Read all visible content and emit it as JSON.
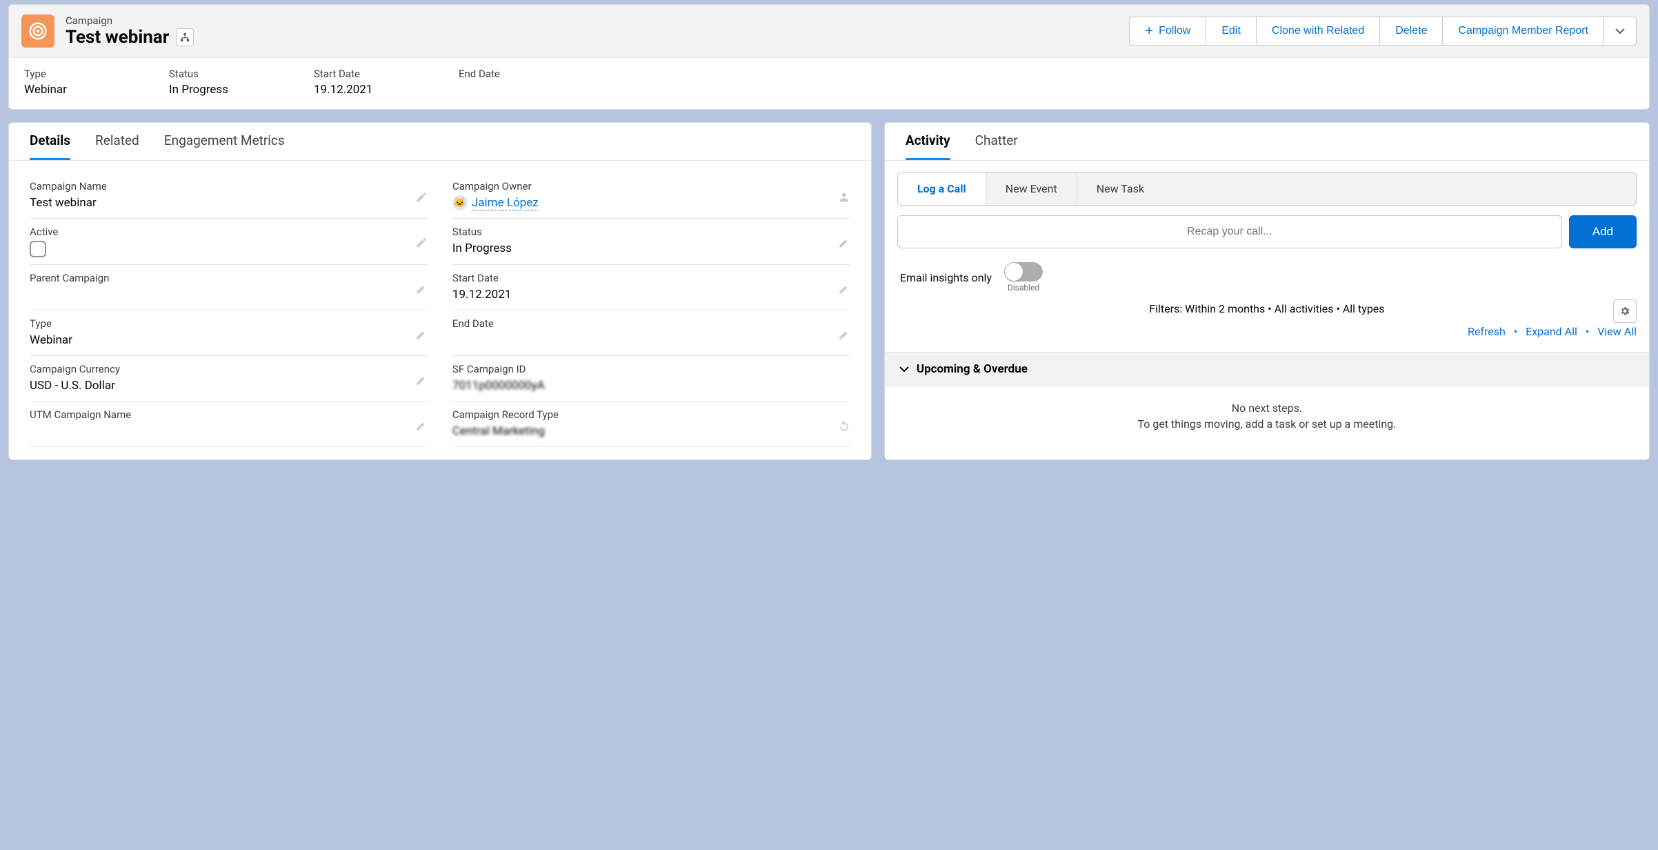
{
  "header": {
    "object_label": "Campaign",
    "record_title": "Test webinar",
    "actions": {
      "follow": "Follow",
      "edit": "Edit",
      "clone": "Clone with Related",
      "delete": "Delete",
      "member_report": "Campaign Member Report"
    },
    "highlights": [
      {
        "label": "Type",
        "value": "Webinar"
      },
      {
        "label": "Status",
        "value": "In Progress"
      },
      {
        "label": "Start Date",
        "value": "19.12.2021"
      },
      {
        "label": "End Date",
        "value": ""
      }
    ]
  },
  "left": {
    "tabs": {
      "details": "Details",
      "related": "Related",
      "engagement": "Engagement Metrics"
    },
    "fields": {
      "campaign_name": {
        "label": "Campaign Name",
        "value": "Test webinar"
      },
      "campaign_owner": {
        "label": "Campaign Owner",
        "value": "Jaime López"
      },
      "active": {
        "label": "Active"
      },
      "status": {
        "label": "Status",
        "value": "In Progress"
      },
      "parent_campaign": {
        "label": "Parent Campaign",
        "value": ""
      },
      "start_date": {
        "label": "Start Date",
        "value": "19.12.2021"
      },
      "type": {
        "label": "Type",
        "value": "Webinar"
      },
      "end_date": {
        "label": "End Date",
        "value": ""
      },
      "campaign_currency": {
        "label": "Campaign Currency",
        "value": "USD - U.S. Dollar"
      },
      "sf_campaign_id": {
        "label": "SF Campaign ID",
        "value": "7011p0000000yA"
      },
      "utm_campaign_name": {
        "label": "UTM Campaign Name",
        "value": ""
      },
      "campaign_record_type": {
        "label": "Campaign Record Type",
        "value": "Central Marketing"
      }
    }
  },
  "right": {
    "tabs": {
      "activity": "Activity",
      "chatter": "Chatter"
    },
    "subtabs": {
      "log_call": "Log a Call",
      "new_event": "New Event",
      "new_task": "New Task"
    },
    "call_input_placeholder": "Recap your call...",
    "add_button": "Add",
    "toggle": {
      "label": "Email insights only",
      "state": "Disabled"
    },
    "filters_text": "Filters: Within 2 months • All activities • All types",
    "links": {
      "refresh": "Refresh",
      "expand_all": "Expand All",
      "view_all": "View All"
    },
    "section_title": "Upcoming & Overdue",
    "empty": {
      "line1": "No next steps.",
      "line2": "To get things moving, add a task or set up a meeting."
    }
  }
}
